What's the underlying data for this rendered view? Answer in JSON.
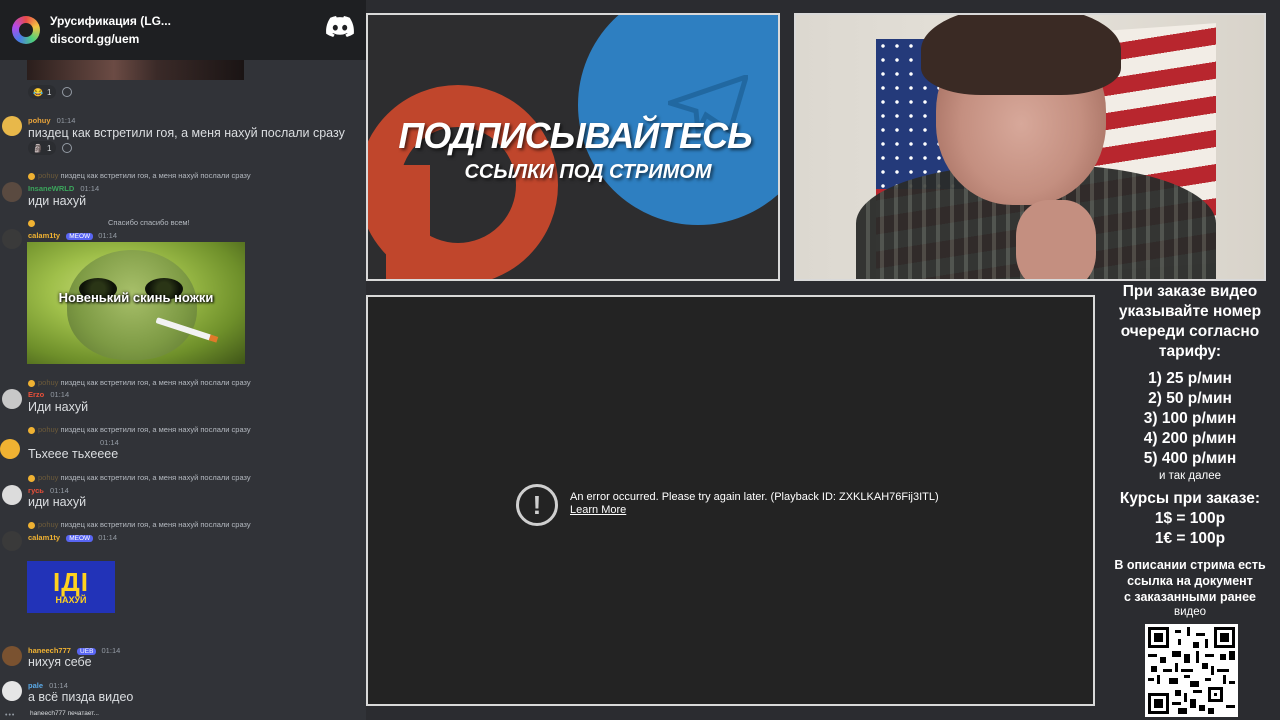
{
  "discord": {
    "server_name": "Урусификация (LG...",
    "invite": "discord.gg/uem",
    "logo_icon": "discord-logo-icon"
  },
  "chat": {
    "reactions_1": {
      "emoji": "😂",
      "count": "1"
    },
    "reactions_2": {
      "emoji": "🗿",
      "count": "1"
    },
    "messages": [
      {
        "user": "pohuy",
        "time": "01:14",
        "text": "пиздец как встретили гоя, а меня нахуй послали сразу",
        "color": "#e8a33a"
      },
      {
        "user": "InsaneWRLD",
        "time": "01:14",
        "text": "иди нахуй",
        "reply": "пиздец как встретили гоя, а меня нахуй послали сразу",
        "reply_user": "pohuy",
        "color": "#3ba55c"
      },
      {
        "user": "calam1ty",
        "tag": "MEOW",
        "time": "01:14",
        "text": "",
        "reply": "Спасибо спасибо всем!",
        "color": "#f0b232"
      },
      {
        "user": "Erzo",
        "time": "01:14",
        "text": "Иди нахуй",
        "reply": "пиздец как встретили гоя, а меня нахуй послали сразу",
        "reply_user": "pohuy",
        "color": "#e8503a"
      },
      {
        "user": "",
        "time": "01:14",
        "text": "Тьхеее тьхееее",
        "reply": "пиздец как встретили гоя, а меня нахуй послали сразу",
        "reply_user": "pohuy",
        "color": "#dbdee1"
      },
      {
        "user": "гусь",
        "time": "01:14",
        "text": "иди нахуй",
        "reply": "пиздец как встретили гоя, а меня нахуй послали сразу",
        "reply_user": "pohuy",
        "color": "#e8503a"
      },
      {
        "user": "calam1ty",
        "tag": "MEOW",
        "time": "01:14",
        "text": "",
        "reply": "пиздец как встретили гоя, а меня нахуй послали сразу",
        "reply_user": "pohuy",
        "color": "#f0b232"
      },
      {
        "user": "haneech777",
        "tag": "UEB",
        "time": "01:14",
        "text": "нихуя себе",
        "color": "#f0b232"
      },
      {
        "user": "pale",
        "time": "01:14",
        "text": "а всё пизда видео",
        "color": "#5aa9e6"
      }
    ],
    "gif_caption": "Новенький скинь ножки",
    "sticker_big": "ІДІ",
    "sticker_small": "НАХУЙ",
    "typing": "haneech777 печатает..."
  },
  "promo": {
    "title": "ПОДПИСЫВАЙТЕСЬ",
    "subtitle": "ССЫЛКИ ПОД СТРИМОМ",
    "icons": [
      "patreon-icon",
      "telegram-icon"
    ],
    "colors": {
      "patreon": "#c0462c",
      "telegram": "#2e7fc1"
    }
  },
  "player": {
    "error_message": "An error occurred. Please try again later. (Playback ID: ZXKLKAH76Fij3ITL)",
    "learn_more": "Learn More",
    "icon": "error-icon"
  },
  "pricing": {
    "heading_lines": [
      "При заказе видео",
      "указывайте номер",
      "очереди согласно",
      "тарифу:"
    ],
    "rates": [
      "1) 25 р/мин",
      "2) 50 р/мин",
      "3) 100 р/мин",
      "4) 200 р/мин",
      "5) 400 р/мин"
    ],
    "etc": "и так далее",
    "courses_title": "Курсы при заказе:",
    "courses": [
      "1$ = 100р",
      "1€ = 100р"
    ],
    "note_lines": [
      "В описании стрима есть",
      "ссылка на документ",
      "с заказанными ранее",
      "видео"
    ],
    "qr_icon": "qr-code-icon"
  }
}
